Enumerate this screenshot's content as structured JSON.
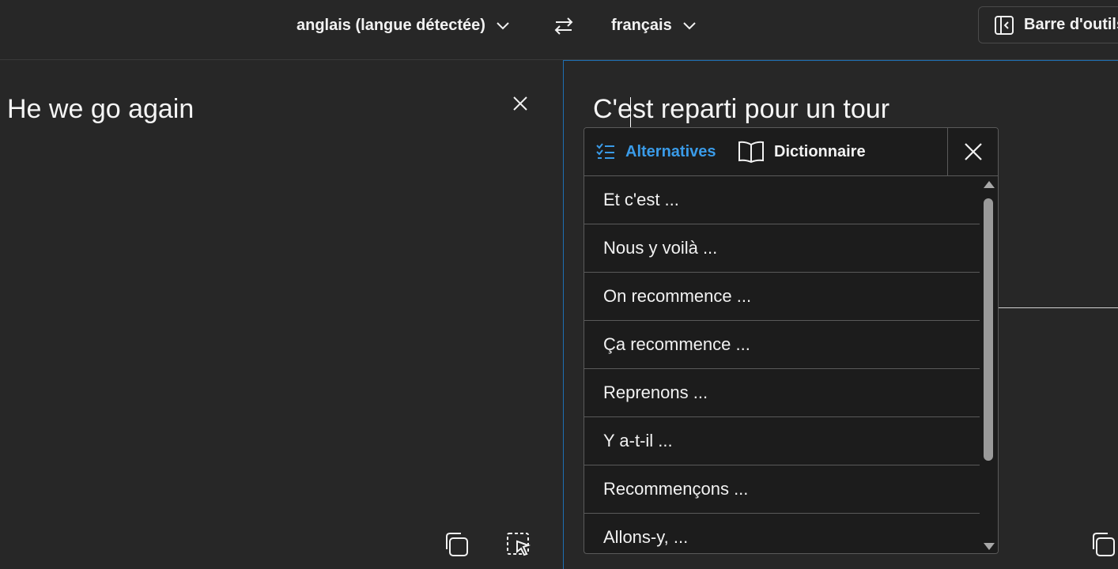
{
  "topbar": {
    "source_language": "anglais (langue détectée)",
    "target_language": "français",
    "toolbar_label": "Barre d'outils"
  },
  "source": {
    "text": "He we go again"
  },
  "target": {
    "text": "C'est reparti pour un tour"
  },
  "alternatives_popup": {
    "tab_alternatives": "Alternatives",
    "tab_dictionary": "Dictionnaire",
    "items": [
      "Et c'est ...",
      "Nous y voilà ...",
      "On recommence ...",
      "Ça recommence ...",
      "Reprenons ...",
      "Y a-t-il ...",
      "Recommençons ...",
      "Allons-y, ..."
    ]
  },
  "colors": {
    "accent": "#3a9be8",
    "background": "#272727",
    "popup_background": "#1c1c1c"
  },
  "icons": [
    "chevron-down-icon",
    "swap-icon",
    "sidebar-collapse-icon",
    "close-icon",
    "copy-icon",
    "select-cursor-icon",
    "list-icon",
    "book-icon"
  ]
}
